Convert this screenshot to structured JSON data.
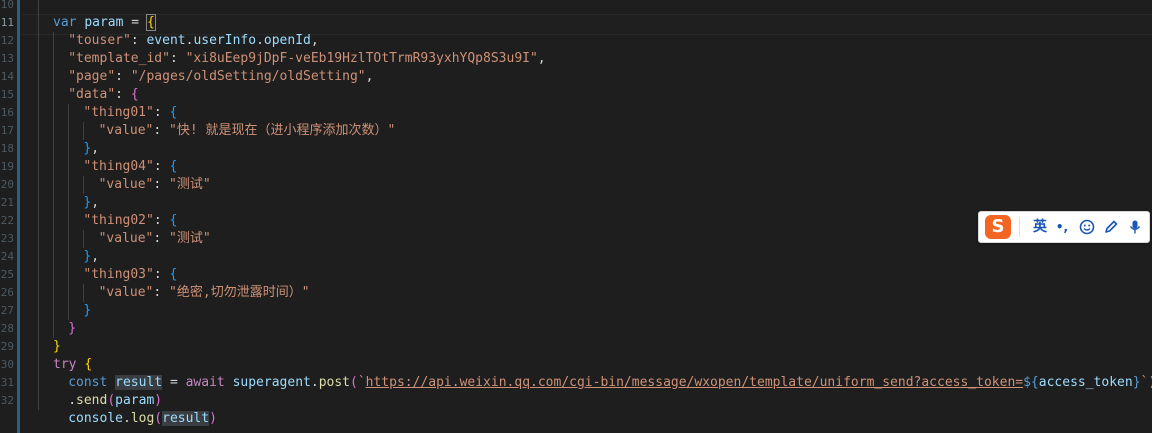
{
  "editor": {
    "line_numbers": [
      "10",
      "11",
      "12",
      "13",
      "14",
      "15",
      "16",
      "17",
      "18",
      "19",
      "20",
      "21",
      "22",
      "23",
      "24",
      "25",
      "26",
      "27",
      "28",
      "29",
      "30",
      "31",
      "32"
    ],
    "active_line": "11",
    "lines": [
      {
        "indent": 0,
        "parts": []
      },
      {
        "indent": 0,
        "parts": [
          [
            "kw",
            "var"
          ],
          [
            "pun",
            " "
          ],
          [
            "var",
            "param"
          ],
          [
            "pun",
            " = "
          ],
          [
            "brc",
            "{"
          ]
        ]
      },
      {
        "indent": 2,
        "parts": [
          [
            "key",
            "\"touser\""
          ],
          [
            "pun",
            ": "
          ],
          [
            "var",
            "event"
          ],
          [
            "pun",
            "."
          ],
          [
            "var",
            "userInfo"
          ],
          [
            "pun",
            "."
          ],
          [
            "var",
            "openId"
          ],
          [
            "pun",
            ","
          ]
        ]
      },
      {
        "indent": 2,
        "parts": [
          [
            "key",
            "\"template_id\""
          ],
          [
            "pun",
            ": "
          ],
          [
            "str",
            "\"xi8uEep9jDpF-veEb19HzlTOtTrmR93yxhYQp8S3u9I\""
          ],
          [
            "pun",
            ","
          ]
        ]
      },
      {
        "indent": 2,
        "parts": [
          [
            "key",
            "\"page\""
          ],
          [
            "pun",
            ": "
          ],
          [
            "str",
            "\"/pages/oldSetting/oldSetting\""
          ],
          [
            "pun",
            ","
          ]
        ]
      },
      {
        "indent": 2,
        "parts": [
          [
            "key",
            "\"data\""
          ],
          [
            "pun",
            ": "
          ],
          [
            "brc2",
            "{"
          ]
        ]
      },
      {
        "indent": 4,
        "parts": [
          [
            "key",
            "\"thing01\""
          ],
          [
            "pun",
            ": "
          ],
          [
            "brc3",
            "{"
          ]
        ]
      },
      {
        "indent": 6,
        "parts": [
          [
            "key",
            "\"value\""
          ],
          [
            "pun",
            ": "
          ],
          [
            "str",
            "\"快! 就是现在（进小程序添加次数）\""
          ]
        ]
      },
      {
        "indent": 4,
        "parts": [
          [
            "brc3",
            "}"
          ],
          [
            "pun",
            ","
          ]
        ]
      },
      {
        "indent": 4,
        "parts": [
          [
            "key",
            "\"thing04\""
          ],
          [
            "pun",
            ": "
          ],
          [
            "brc3",
            "{"
          ]
        ]
      },
      {
        "indent": 6,
        "parts": [
          [
            "key",
            "\"value\""
          ],
          [
            "pun",
            ": "
          ],
          [
            "str",
            "\"测试\""
          ]
        ]
      },
      {
        "indent": 4,
        "parts": [
          [
            "brc3",
            "}"
          ],
          [
            "pun",
            ","
          ]
        ]
      },
      {
        "indent": 4,
        "parts": [
          [
            "key",
            "\"thing02\""
          ],
          [
            "pun",
            ": "
          ],
          [
            "brc3",
            "{"
          ]
        ]
      },
      {
        "indent": 6,
        "parts": [
          [
            "key",
            "\"value\""
          ],
          [
            "pun",
            ": "
          ],
          [
            "str",
            "\"测试\""
          ]
        ]
      },
      {
        "indent": 4,
        "parts": [
          [
            "brc3",
            "}"
          ],
          [
            "pun",
            ","
          ]
        ]
      },
      {
        "indent": 4,
        "parts": [
          [
            "key",
            "\"thing03\""
          ],
          [
            "pun",
            ": "
          ],
          [
            "brc3",
            "{"
          ]
        ]
      },
      {
        "indent": 6,
        "parts": [
          [
            "key",
            "\"value\""
          ],
          [
            "pun",
            ": "
          ],
          [
            "str",
            "\"绝密,切勿泄露时间）\""
          ]
        ]
      },
      {
        "indent": 4,
        "parts": [
          [
            "brc3",
            "}"
          ]
        ]
      },
      {
        "indent": 2,
        "parts": [
          [
            "brc2",
            "}"
          ]
        ]
      },
      {
        "indent": 0,
        "parts": [
          [
            "brc",
            "}"
          ]
        ]
      },
      {
        "indent": 0,
        "parts": [
          [
            "kw2",
            "try"
          ],
          [
            "pun",
            " "
          ],
          [
            "brc",
            "{"
          ]
        ]
      },
      {
        "indent": 2,
        "parts": [
          [
            "kw",
            "const"
          ],
          [
            "pun",
            " "
          ],
          [
            "var hl",
            "result"
          ],
          [
            "pun",
            " = "
          ],
          [
            "kw2",
            "await"
          ],
          [
            "pun",
            " "
          ],
          [
            "var",
            "superagent"
          ],
          [
            "pun",
            "."
          ],
          [
            "fn",
            "post"
          ],
          [
            "brc2",
            "("
          ],
          [
            "str",
            "`"
          ],
          [
            "url",
            "https://api.weixin.qq.com/cgi-bin/message/wxopen/template/uniform_send?access_token="
          ],
          [
            "tplx",
            "${"
          ],
          [
            "var",
            "access_token"
          ],
          [
            "tplx",
            "}"
          ],
          [
            "str",
            "`"
          ],
          [
            "brc2",
            ")"
          ]
        ]
      },
      {
        "indent": 2,
        "parts": [
          [
            "pun",
            "."
          ],
          [
            "fn",
            "send"
          ],
          [
            "brc2",
            "("
          ],
          [
            "var",
            "param"
          ],
          [
            "brc2",
            ")"
          ]
        ]
      },
      {
        "indent": 2,
        "parts": [
          [
            "var",
            "console"
          ],
          [
            "pun",
            "."
          ],
          [
            "fn",
            "log"
          ],
          [
            "brc2",
            "("
          ],
          [
            "var hl",
            "result"
          ],
          [
            "brc2",
            ")"
          ]
        ]
      }
    ]
  },
  "ime_toolbar": {
    "logo": "S",
    "mode": "英",
    "punct": "•,",
    "emoji_icon": "smile-icon",
    "pen_icon": "pen-icon",
    "mic_icon": "microphone-icon",
    "brand_color": "#f26522"
  }
}
